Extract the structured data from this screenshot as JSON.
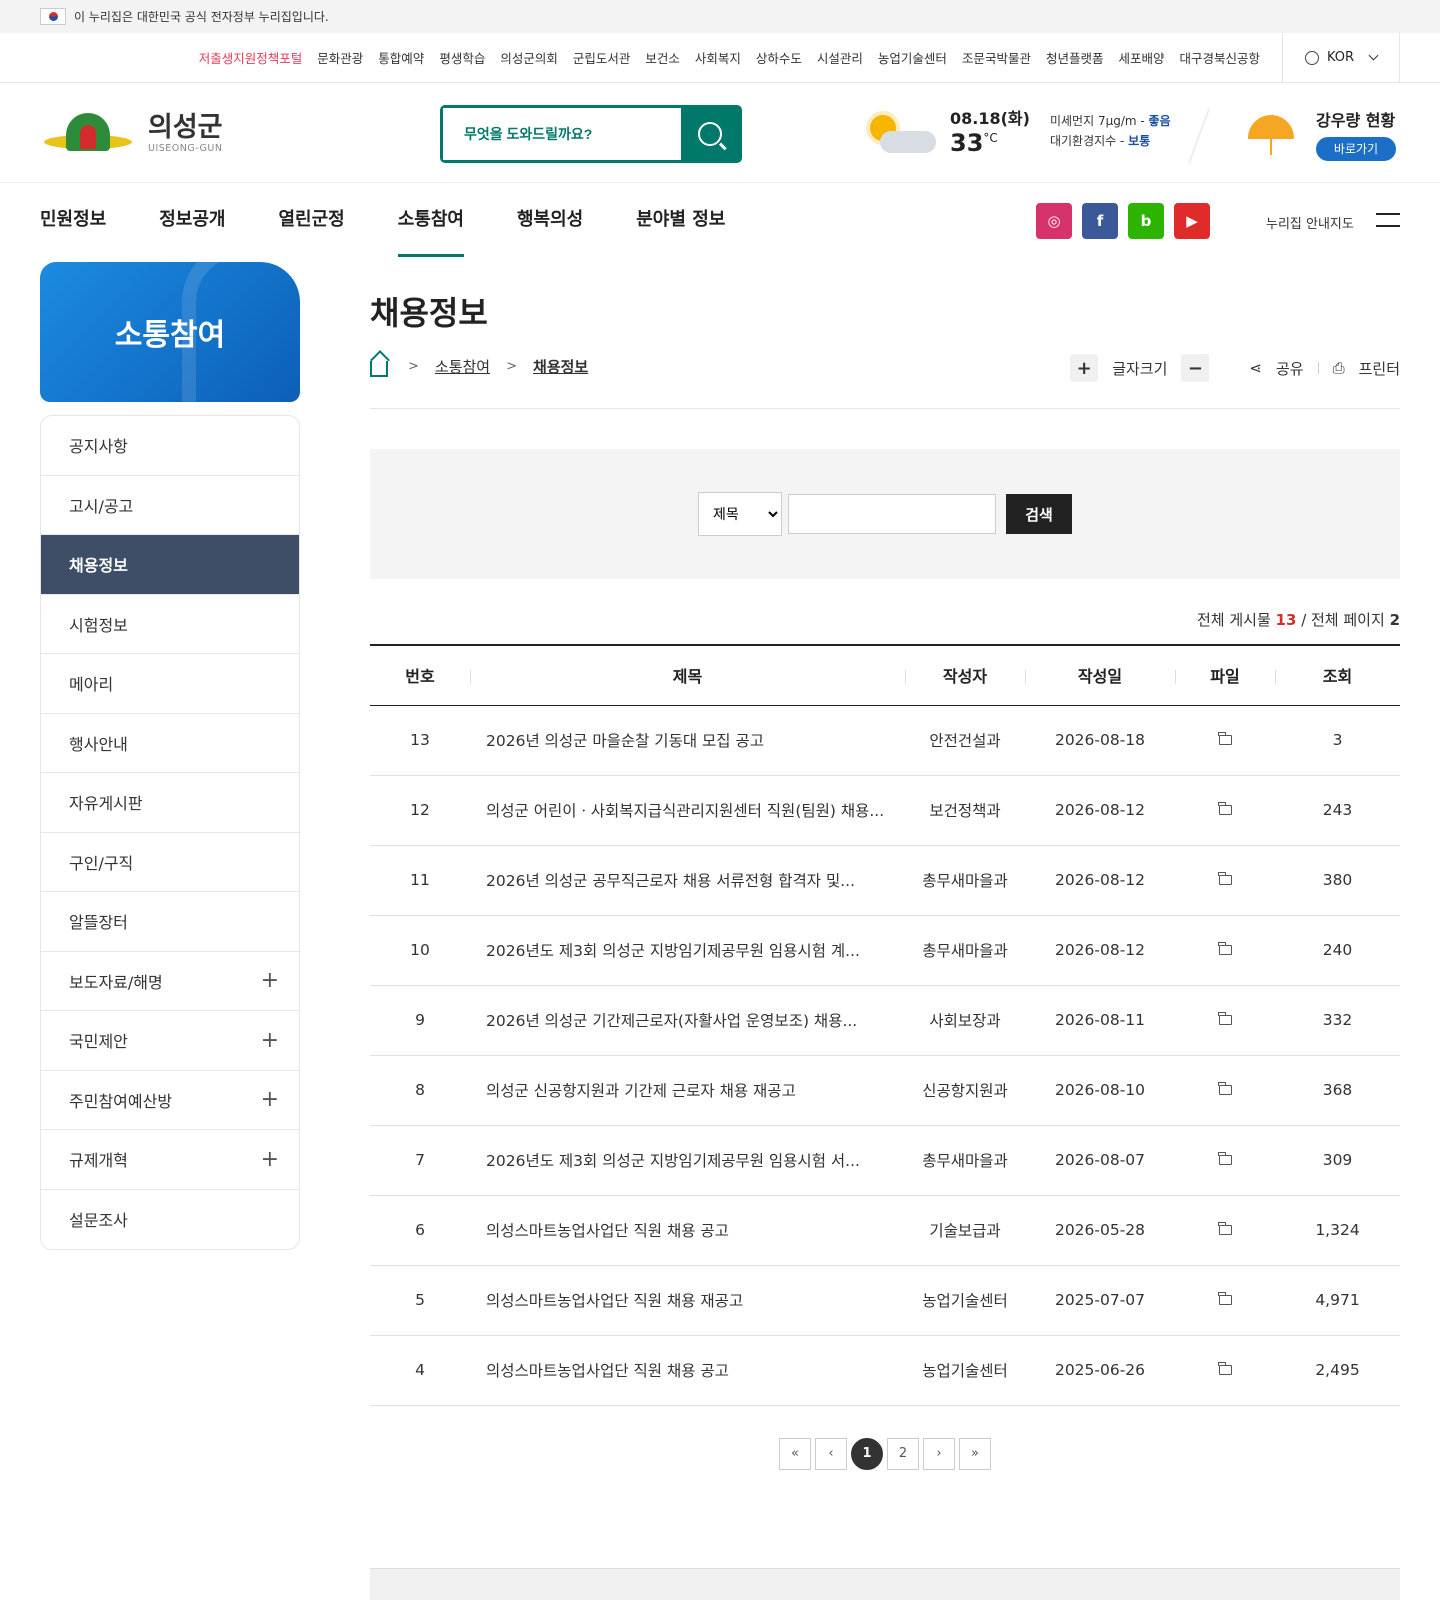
{
  "gov_banner": "이 누리집은 대한민국 공식 전자정부 누리집입니다.",
  "util_links": [
    "저출생지원정책포털",
    "문화관광",
    "통합예약",
    "평생학습",
    "의성군의회",
    "군립도서관",
    "보건소",
    "사회복지",
    "상하수도",
    "시설관리",
    "농업기술센터",
    "조문국박물관",
    "청년플랫폼",
    "세포배양",
    "대구경북신공항"
  ],
  "lang": "KOR",
  "logo": {
    "name": "의성군",
    "sub": "UISEONG-GUN"
  },
  "search": {
    "placeholder": "무엇을 도와드릴까요?"
  },
  "weather": {
    "date": "08.18(화)",
    "temp": "33",
    "unit": "°C",
    "dust_label": "미세먼지 7μg/m - ",
    "dust_status": "좋음",
    "air_label": "대기환경지수 - ",
    "air_status": "보통"
  },
  "rain": {
    "title": "강우량 현황",
    "button": "바로가기"
  },
  "gnb": [
    "민원정보",
    "정보공개",
    "열린군정",
    "소통참여",
    "행복의성",
    "분야별 정보"
  ],
  "gnb_active_index": 3,
  "sns": [
    {
      "name": "instagram",
      "label": "◎",
      "color": "#d6336c"
    },
    {
      "name": "facebook",
      "label": "f",
      "color": "#3b5998"
    },
    {
      "name": "blog",
      "label": "b",
      "color": "#2db400"
    },
    {
      "name": "youtube",
      "label": "▶",
      "color": "#e02b2b"
    }
  ],
  "sitemap": "누리집 안내지도",
  "side": {
    "title": "소통참여",
    "items": [
      {
        "label": "공지사항",
        "plus": false
      },
      {
        "label": "고시/공고",
        "plus": false
      },
      {
        "label": "채용정보",
        "plus": false,
        "active": true
      },
      {
        "label": "시험정보",
        "plus": false
      },
      {
        "label": "메아리",
        "plus": false
      },
      {
        "label": "행사안내",
        "plus": false
      },
      {
        "label": "자유게시판",
        "plus": false
      },
      {
        "label": "구인/구직",
        "plus": false
      },
      {
        "label": "알뜰장터",
        "plus": false
      },
      {
        "label": "보도자료/해명",
        "plus": true
      },
      {
        "label": "국민제안",
        "plus": true
      },
      {
        "label": "주민참여예산방",
        "plus": true
      },
      {
        "label": "규제개혁",
        "plus": true
      },
      {
        "label": "설문조사",
        "plus": false
      }
    ]
  },
  "page": {
    "title": "채용정보",
    "breadcrumb": [
      "소통참여",
      "채용정보"
    ],
    "font_size": "글자크기",
    "share": "공유",
    "print": "프린터"
  },
  "search_form": {
    "select": "제목",
    "button": "검색"
  },
  "summary": {
    "total_label": "전체 게시물 ",
    "total": "13",
    "pages_label": " / 전체 페이지 ",
    "pages": "2"
  },
  "table": {
    "headers": [
      "번호",
      "제목",
      "작성자",
      "작성일",
      "파일",
      "조회"
    ],
    "rows": [
      [
        "13",
        "2026년 의성군 마을순찰 기동대 모집 공고",
        "안전건설과",
        "2026-08-18",
        "3"
      ],
      [
        "12",
        "의성군 어린이ㆍ사회복지급식관리지원센터 직원(팀원) 채용...",
        "보건정책과",
        "2026-08-12",
        "243"
      ],
      [
        "11",
        "2026년 의성군 공무직근로자 채용 서류전형 합격자 및...",
        "총무새마을과",
        "2026-08-12",
        "380"
      ],
      [
        "10",
        "2026년도 제3회 의성군 지방임기제공무원 임용시험 계...",
        "총무새마을과",
        "2026-08-12",
        "240"
      ],
      [
        "9",
        "2026년 의성군 기간제근로자(자활사업 운영보조) 채용...",
        "사회보장과",
        "2026-08-11",
        "332"
      ],
      [
        "8",
        "의성군 신공항지원과 기간제 근로자 채용 재공고",
        "신공항지원과",
        "2026-08-10",
        "368"
      ],
      [
        "7",
        "2026년도 제3회 의성군 지방임기제공무원 임용시험 서...",
        "총무새마을과",
        "2026-08-07",
        "309"
      ],
      [
        "6",
        "의성스마트농업사업단 직원 채용 공고",
        "기술보급과",
        "2026-05-28",
        "1,324"
      ],
      [
        "5",
        "의성스마트농업사업단 직원 채용 재공고",
        "농업기술센터",
        "2025-07-07",
        "4,971"
      ],
      [
        "4",
        "의성스마트농업사업단 직원 채용 공고",
        "농업기술센터",
        "2025-06-26",
        "2,495"
      ]
    ]
  },
  "pager": {
    "first": "«",
    "prev": "‹",
    "pages": [
      "1",
      "2"
    ],
    "current": "1",
    "next": "›",
    "last": "»"
  }
}
